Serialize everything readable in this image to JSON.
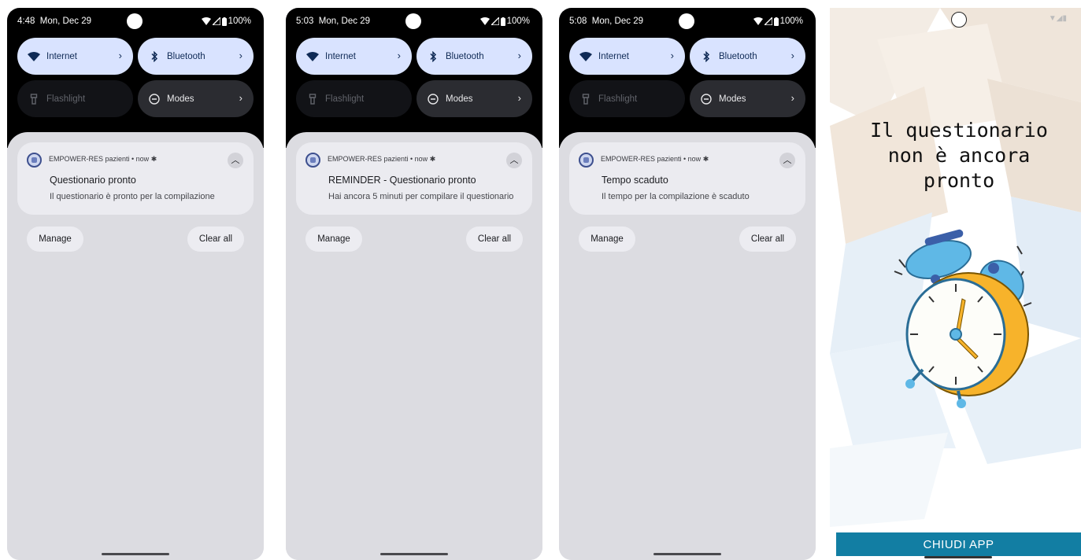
{
  "screens": [
    {
      "status": {
        "time": "4:48",
        "date": "Mon, Dec 29",
        "battery": "100%"
      },
      "tiles": {
        "internet": "Internet",
        "bluetooth": "Bluetooth",
        "flashlight": "Flashlight",
        "modes": "Modes"
      },
      "notification": {
        "app_header": "EMPOWER-RES pazienti • now",
        "title": "Questionario pronto",
        "text": "Il questionario è pronto per la compilazione"
      },
      "manage_label": "Manage",
      "clear_all_label": "Clear all"
    },
    {
      "status": {
        "time": "5:03",
        "date": "Mon, Dec 29",
        "battery": "100%"
      },
      "tiles": {
        "internet": "Internet",
        "bluetooth": "Bluetooth",
        "flashlight": "Flashlight",
        "modes": "Modes"
      },
      "notification": {
        "app_header": "EMPOWER-RES pazienti • now",
        "title": "REMINDER - Questionario pronto",
        "text": "Hai ancora 5 minuti per compilare il questionario"
      },
      "manage_label": "Manage",
      "clear_all_label": "Clear all"
    },
    {
      "status": {
        "time": "5:08",
        "date": "Mon, Dec 29",
        "battery": "100%"
      },
      "tiles": {
        "internet": "Internet",
        "bluetooth": "Bluetooth",
        "flashlight": "Flashlight",
        "modes": "Modes"
      },
      "notification": {
        "app_header": "EMPOWER-RES pazienti • now",
        "title": "Tempo scaduto",
        "text": "Il tempo per la compilazione è scaduto"
      },
      "manage_label": "Manage",
      "clear_all_label": "Clear all"
    }
  ],
  "app_screen": {
    "title_line1": "Il questionario",
    "title_line2": "non è ancora",
    "title_line3": "pronto",
    "close_button": "CHIUDI APP",
    "illustration": "alarm-clock-icon"
  },
  "colors": {
    "tile_active": "#d9e3ff",
    "shade": "#dcdce1",
    "close_button": "#127ea3",
    "clock_body": "#f7b32b",
    "clock_bells": "#5fb8e6"
  }
}
